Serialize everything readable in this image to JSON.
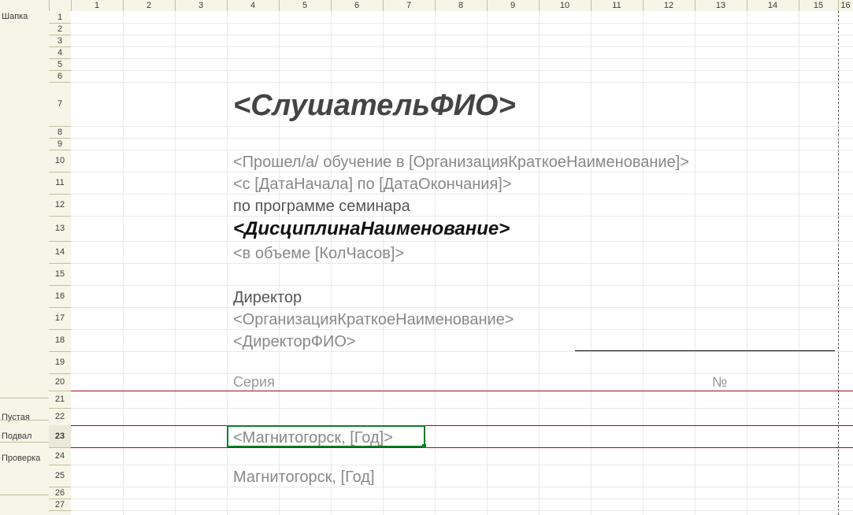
{
  "sections": {
    "header": "Шапка",
    "empty": "Пустая",
    "footer": "Подвал",
    "check": "Проверка"
  },
  "columns": [
    "1",
    "2",
    "3",
    "4",
    "5",
    "6",
    "7",
    "8",
    "9",
    "10",
    "11",
    "12",
    "13",
    "14",
    "15",
    "16"
  ],
  "rows": {
    "r7": "<СлушательФИО>",
    "r10": "<Прошел/а/ обучение в [ОрганизацияКраткоеНаименование]>",
    "r11": "<с [ДатаНачала] по [ДатаОкончания]>",
    "r12": "по программе семинара",
    "r13": "<ДисциплинаНаименование>",
    "r14": "<в объеме [КолЧасов]>",
    "r16": "Директор",
    "r17": "<ОрганизацияКраткоеНаименование>",
    "r18": "<ДиректорФИО>",
    "r20_a": "Серия",
    "r20_b": "№",
    "r23": "<Магнитогорск, [Год]>",
    "r25": "Магнитогорск, [Год]"
  },
  "row_numbers": [
    "1",
    "2",
    "3",
    "4",
    "5",
    "6",
    "7",
    "8",
    "9",
    "10",
    "11",
    "12",
    "13",
    "14",
    "15",
    "16",
    "17",
    "18",
    "19",
    "20",
    "21",
    "22",
    "23",
    "24",
    "25",
    "26",
    "27"
  ],
  "selected_row": "23"
}
